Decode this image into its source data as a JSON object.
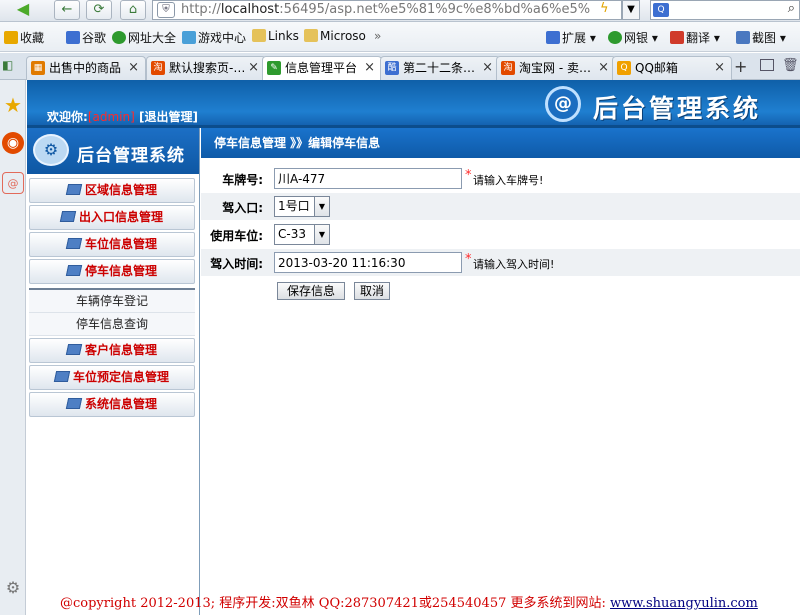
{
  "browser": {
    "back_icon": "back-arrow-icon",
    "refresh_icon": "refresh-icon",
    "home_icon": "home-icon",
    "url_prefix": "http://",
    "url_host": "localhost",
    "url_rest": ":56495/asp.net%e5%81%9c%e8%bd%a6%e5%",
    "search_placeholder": "",
    "favorites": [
      {
        "label": "收藏",
        "color": "#e8a800"
      },
      {
        "label": "谷歌",
        "color": "#3d6fd1"
      },
      {
        "label": "网址大全",
        "color": "#2e9a2e"
      },
      {
        "label": "游戏中心",
        "color": "#4aa0d8"
      },
      {
        "label": "Links",
        "color": "#e5c25a"
      },
      {
        "label": "Microso",
        "color": "#e5c25a"
      }
    ],
    "favorites_more": "»",
    "tools": [
      {
        "label": "扩展",
        "color": "#3d6fd1"
      },
      {
        "label": "网银",
        "color": "#2e9a2e"
      },
      {
        "label": "翻译",
        "color": "#d03a2a"
      },
      {
        "label": "截图",
        "color": "#4a78c0"
      }
    ],
    "tabs": [
      {
        "label": "出售中的商品",
        "icon_color": "#e07a00",
        "active": false
      },
      {
        "label": "默认搜索页-…",
        "icon_color": "#e24a00",
        "active": false
      },
      {
        "label": "信息管理平台",
        "icon_color": "#2e9a2e",
        "active": true
      },
      {
        "label": "第二十二条…",
        "icon_color": "#3d6fd1",
        "active": false
      },
      {
        "label": "淘宝网 - 卖…",
        "icon_color": "#e24a00",
        "active": false
      },
      {
        "label": "QQ邮箱",
        "icon_color": "#f0a000",
        "active": false
      }
    ],
    "tab_close": "×",
    "new_tab": "+"
  },
  "header": {
    "welcome_prefix": "欢迎你:",
    "username": "[admin]",
    "logout": "[退出管理]",
    "logo_glyph": "@",
    "title": "后台管理系统"
  },
  "sidebar": {
    "title": "后台管理系统",
    "menu_top": [
      "区域信息管理",
      "出入口信息管理",
      "车位信息管理",
      "停车信息管理"
    ],
    "submenu": [
      "车辆停车登记",
      "停车信息查询"
    ],
    "menu_bottom": [
      "客户信息管理",
      "车位预定信息管理",
      "系统信息管理"
    ]
  },
  "content": {
    "breadcrumb": "停车信息管理 》》编辑停车信息",
    "form": {
      "plate_label": "车牌号:",
      "plate_value": "川A-477",
      "plate_hint": "请输入车牌号!",
      "entrance_label": "驾入口:",
      "entrance_value": "1号口",
      "space_label": "使用车位:",
      "space_value": "C-33",
      "time_label": "驾入时间:",
      "time_value": "2013-03-20 11:16:30",
      "time_hint": "请输入驾入时间!",
      "required_mark": "*",
      "save_button": "保存信息",
      "cancel_button": "取消"
    }
  },
  "footer": {
    "text": "@copyright 2012-2013; 程序开发:双鱼林  QQ:287307421或254540457  更多系统到网站:",
    "link": "www.shuangyulin.com"
  }
}
